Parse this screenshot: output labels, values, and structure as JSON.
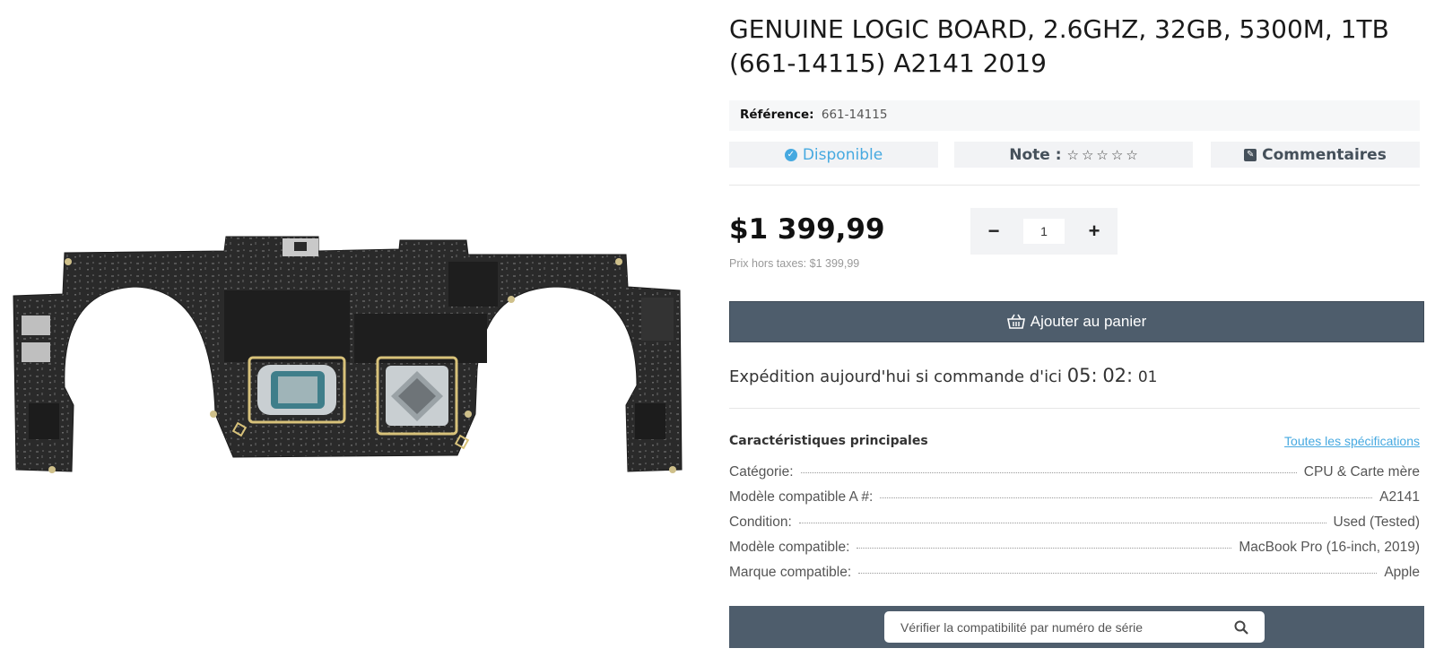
{
  "product": {
    "title": "GENUINE LOGIC BOARD, 2.6GHZ, 32GB, 5300M, 1TB (661-14115) A2141 2019",
    "reference_label": "Référence:",
    "reference_value": "661-14115",
    "availability": "Disponible",
    "rating_label": "Note :",
    "rating_stars": 0,
    "rating_max": 5,
    "comments_label": "Commentaires",
    "price": "$1 399,99",
    "price_ht": "Prix hors taxes: $1 399,99",
    "quantity": "1",
    "qty_minus": "−",
    "qty_plus": "+",
    "add_to_cart": "Ajouter au panier"
  },
  "shipping": {
    "text": "Expédition aujourd'hui si commande d'ici",
    "hours": "05",
    "minutes": "02",
    "seconds": "01"
  },
  "specs": {
    "heading": "Caractéristiques principales",
    "all_link": "Toutes les spécifications",
    "rows": [
      {
        "label": "Catégorie:",
        "value": "CPU & Carte mère"
      },
      {
        "label": "Modèle compatible A #:",
        "value": "A2141"
      },
      {
        "label": "Condition:",
        "value": "Used (Tested)"
      },
      {
        "label": "Modèle compatible:",
        "value": "MacBook Pro (16-inch, 2019)"
      },
      {
        "label": "Marque compatible:",
        "value": "Apple"
      }
    ]
  },
  "serial_search": {
    "placeholder": "Vérifier la compatibilité par numéro de série"
  },
  "colors": {
    "accent": "#46a9e0",
    "button_dark": "#4e5d6c",
    "board": "#2b2b2b",
    "gold": "#d8c27a"
  },
  "icons": {
    "check": "check-circle-icon",
    "edit": "edit-icon",
    "basket": "basket-icon",
    "search": "search-icon",
    "star": "star-outline-icon"
  }
}
